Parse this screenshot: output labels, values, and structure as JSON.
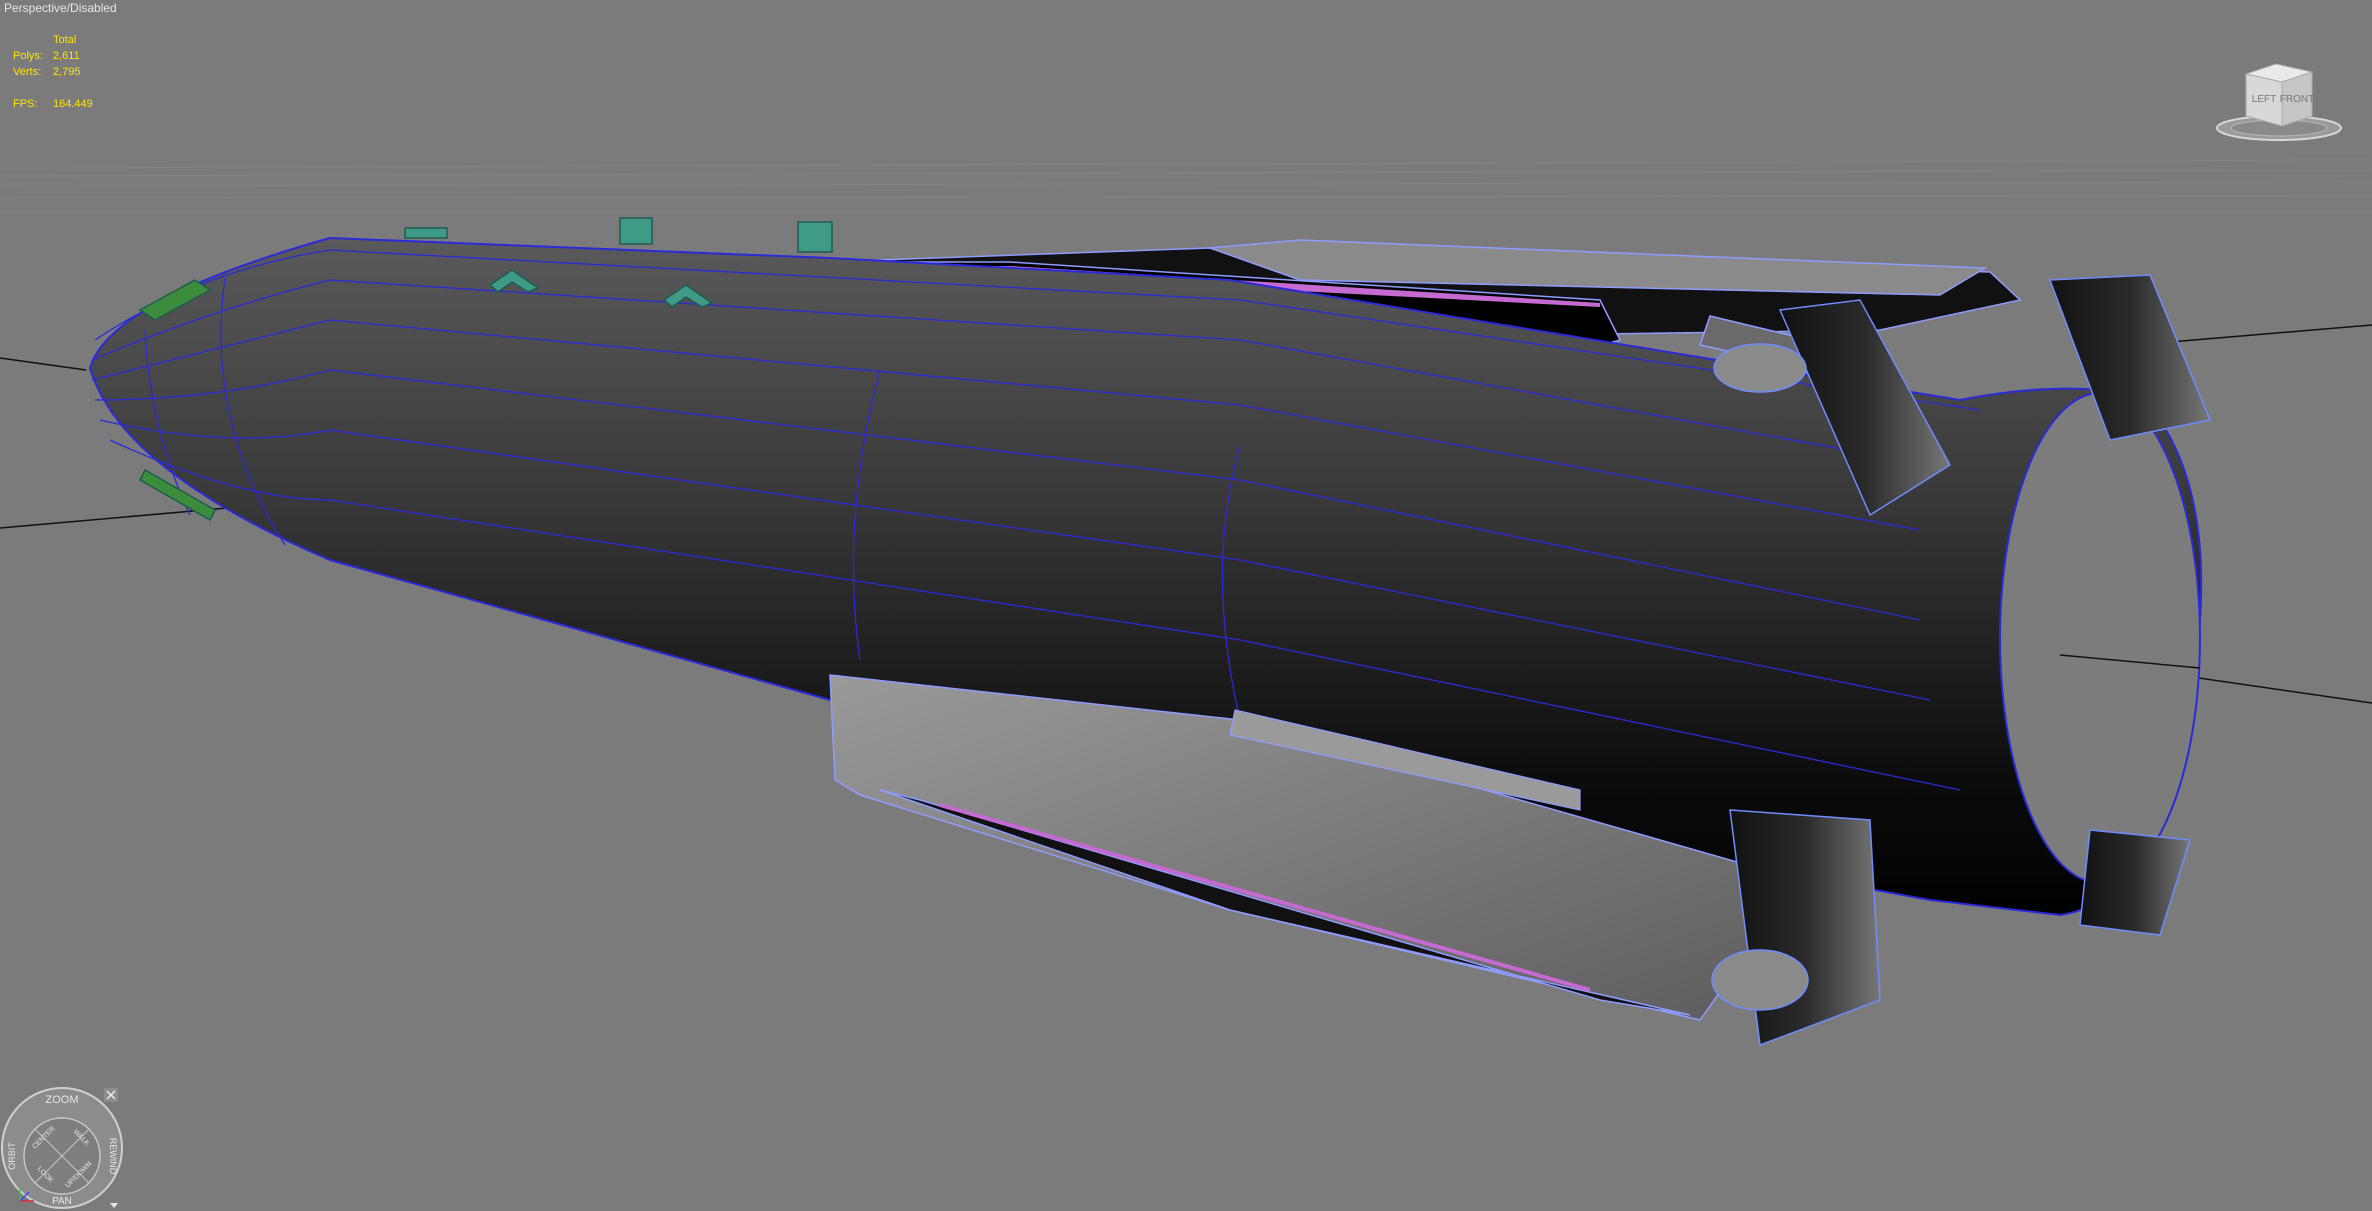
{
  "viewport": {
    "label": "Perspective/Disabled"
  },
  "stats": {
    "header": "Total",
    "rows": [
      {
        "label": "Polys:",
        "value": "2,611"
      },
      {
        "label": "Verts:",
        "value": "2,795"
      }
    ],
    "fps_label": "FPS:",
    "fps_value": "164.449"
  },
  "viewcube": {
    "faces": {
      "left": "LEFT",
      "front": "FRONT"
    }
  },
  "steering_wheel": {
    "zoom": "ZOOM",
    "orbit": "ORBIT",
    "rewind": "REWIND",
    "pan": "PAN",
    "center": "CENTER",
    "walk": "WALK",
    "look": "LOOK",
    "up_down": "UP/DOWN"
  },
  "colors": {
    "background": "#7b7b7b",
    "stats_text": "#ffe400",
    "wire": "#2a2ad8",
    "wire_light": "#8f9cff",
    "accent_green": "#3f9a86"
  },
  "icons": [
    "viewcube-icon",
    "steering-wheel-icon",
    "close-icon"
  ]
}
